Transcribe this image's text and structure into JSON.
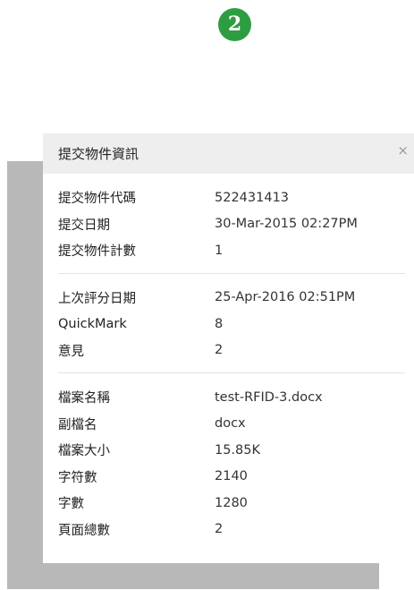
{
  "step_badge": "2",
  "dialog": {
    "title": "提交物件資訊",
    "close": "×"
  },
  "sections": [
    {
      "rows": [
        {
          "label": "提交物件代碼",
          "value": "522431413"
        },
        {
          "label": "提交日期",
          "value": "30-Mar-2015 02:27PM"
        },
        {
          "label": "提交物件計數",
          "value": "1"
        }
      ]
    },
    {
      "rows": [
        {
          "label": "上次評分日期",
          "value": "25-Apr-2016 02:51PM"
        },
        {
          "label": "QuickMark",
          "value": "8"
        },
        {
          "label": "意見",
          "value": "2"
        }
      ]
    },
    {
      "rows": [
        {
          "label": "檔案名稱",
          "value": "test-RFID-3.docx"
        },
        {
          "label": "副檔名",
          "value": "docx"
        },
        {
          "label": "檔案大小",
          "value": "15.85K"
        },
        {
          "label": "字符數",
          "value": "2140"
        },
        {
          "label": "字數",
          "value": "1280"
        },
        {
          "label": "頁面總數",
          "value": "2"
        }
      ]
    }
  ],
  "colors": {
    "badge": "#2e9d41",
    "shadow": "#b8b8b8",
    "header_bg": "#eeeeee",
    "divider": "#e3e3e3"
  }
}
